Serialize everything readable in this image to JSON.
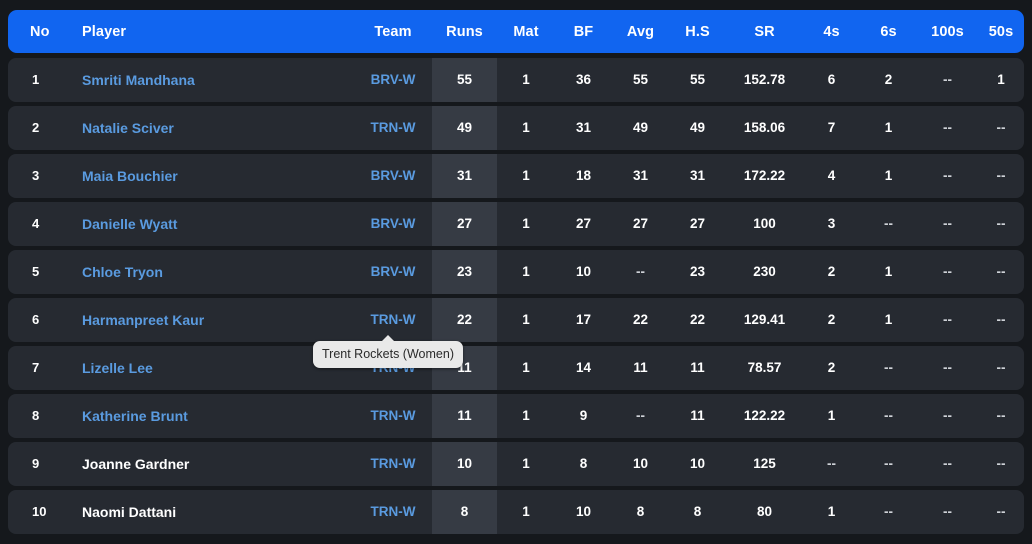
{
  "table": {
    "columns": [
      {
        "key": "no",
        "label": "No"
      },
      {
        "key": "player",
        "label": "Player"
      },
      {
        "key": "team",
        "label": "Team"
      },
      {
        "key": "runs",
        "label": "Runs"
      },
      {
        "key": "mat",
        "label": "Mat"
      },
      {
        "key": "bf",
        "label": "BF"
      },
      {
        "key": "avg",
        "label": "Avg"
      },
      {
        "key": "hs",
        "label": "H.S"
      },
      {
        "key": "sr",
        "label": "SR"
      },
      {
        "key": "fours",
        "label": "4s"
      },
      {
        "key": "sixes",
        "label": "6s"
      },
      {
        "key": "hundreds",
        "label": "100s"
      },
      {
        "key": "fifties",
        "label": "50s"
      }
    ],
    "rows": [
      {
        "no": "1",
        "player": "Smriti Mandhana",
        "player_is_link": true,
        "team": "BRV-W",
        "runs": "55",
        "mat": "1",
        "bf": "36",
        "avg": "55",
        "hs": "55",
        "sr": "152.78",
        "fours": "6",
        "sixes": "2",
        "hundreds": "--",
        "fifties": "1"
      },
      {
        "no": "2",
        "player": "Natalie Sciver",
        "player_is_link": true,
        "team": "TRN-W",
        "runs": "49",
        "mat": "1",
        "bf": "31",
        "avg": "49",
        "hs": "49",
        "sr": "158.06",
        "fours": "7",
        "sixes": "1",
        "hundreds": "--",
        "fifties": "--"
      },
      {
        "no": "3",
        "player": "Maia Bouchier",
        "player_is_link": true,
        "team": "BRV-W",
        "runs": "31",
        "mat": "1",
        "bf": "18",
        "avg": "31",
        "hs": "31",
        "sr": "172.22",
        "fours": "4",
        "sixes": "1",
        "hundreds": "--",
        "fifties": "--"
      },
      {
        "no": "4",
        "player": "Danielle Wyatt",
        "player_is_link": true,
        "team": "BRV-W",
        "runs": "27",
        "mat": "1",
        "bf": "27",
        "avg": "27",
        "hs": "27",
        "sr": "100",
        "fours": "3",
        "sixes": "--",
        "hundreds": "--",
        "fifties": "--"
      },
      {
        "no": "5",
        "player": "Chloe Tryon",
        "player_is_link": true,
        "team": "BRV-W",
        "runs": "23",
        "mat": "1",
        "bf": "10",
        "avg": "--",
        "hs": "23",
        "sr": "230",
        "fours": "2",
        "sixes": "1",
        "hundreds": "--",
        "fifties": "--"
      },
      {
        "no": "6",
        "player": "Harmanpreet Kaur",
        "player_is_link": true,
        "team": "TRN-W",
        "runs": "22",
        "mat": "1",
        "bf": "17",
        "avg": "22",
        "hs": "22",
        "sr": "129.41",
        "fours": "2",
        "sixes": "1",
        "hundreds": "--",
        "fifties": "--"
      },
      {
        "no": "7",
        "player": "Lizelle Lee",
        "player_is_link": true,
        "team": "TRN-W",
        "runs": "11",
        "mat": "1",
        "bf": "14",
        "avg": "11",
        "hs": "11",
        "sr": "78.57",
        "fours": "2",
        "sixes": "--",
        "hundreds": "--",
        "fifties": "--"
      },
      {
        "no": "8",
        "player": "Katherine Brunt",
        "player_is_link": true,
        "team": "TRN-W",
        "runs": "11",
        "mat": "1",
        "bf": "9",
        "avg": "--",
        "hs": "11",
        "sr": "122.22",
        "fours": "1",
        "sixes": "--",
        "hundreds": "--",
        "fifties": "--"
      },
      {
        "no": "9",
        "player": "Joanne Gardner",
        "player_is_link": false,
        "team": "TRN-W",
        "runs": "10",
        "mat": "1",
        "bf": "8",
        "avg": "10",
        "hs": "10",
        "sr": "125",
        "fours": "--",
        "sixes": "--",
        "hundreds": "--",
        "fifties": "--"
      },
      {
        "no": "10",
        "player": "Naomi Dattani",
        "player_is_link": false,
        "team": "TRN-W",
        "runs": "8",
        "mat": "1",
        "bf": "10",
        "avg": "8",
        "hs": "8",
        "sr": "80",
        "fours": "1",
        "sixes": "--",
        "hundreds": "--",
        "fifties": "--"
      }
    ]
  },
  "tooltip": {
    "text": "Trent Rockets (Women)",
    "visible": true
  },
  "colors": {
    "header_bg": "#1165f0",
    "row_bg": "#262a31",
    "runs_column_bg": "#363b44",
    "page_bg": "#15181c",
    "link": "#5a9be0",
    "text": "#ffffff",
    "tooltip_bg": "#e9e9e9"
  }
}
